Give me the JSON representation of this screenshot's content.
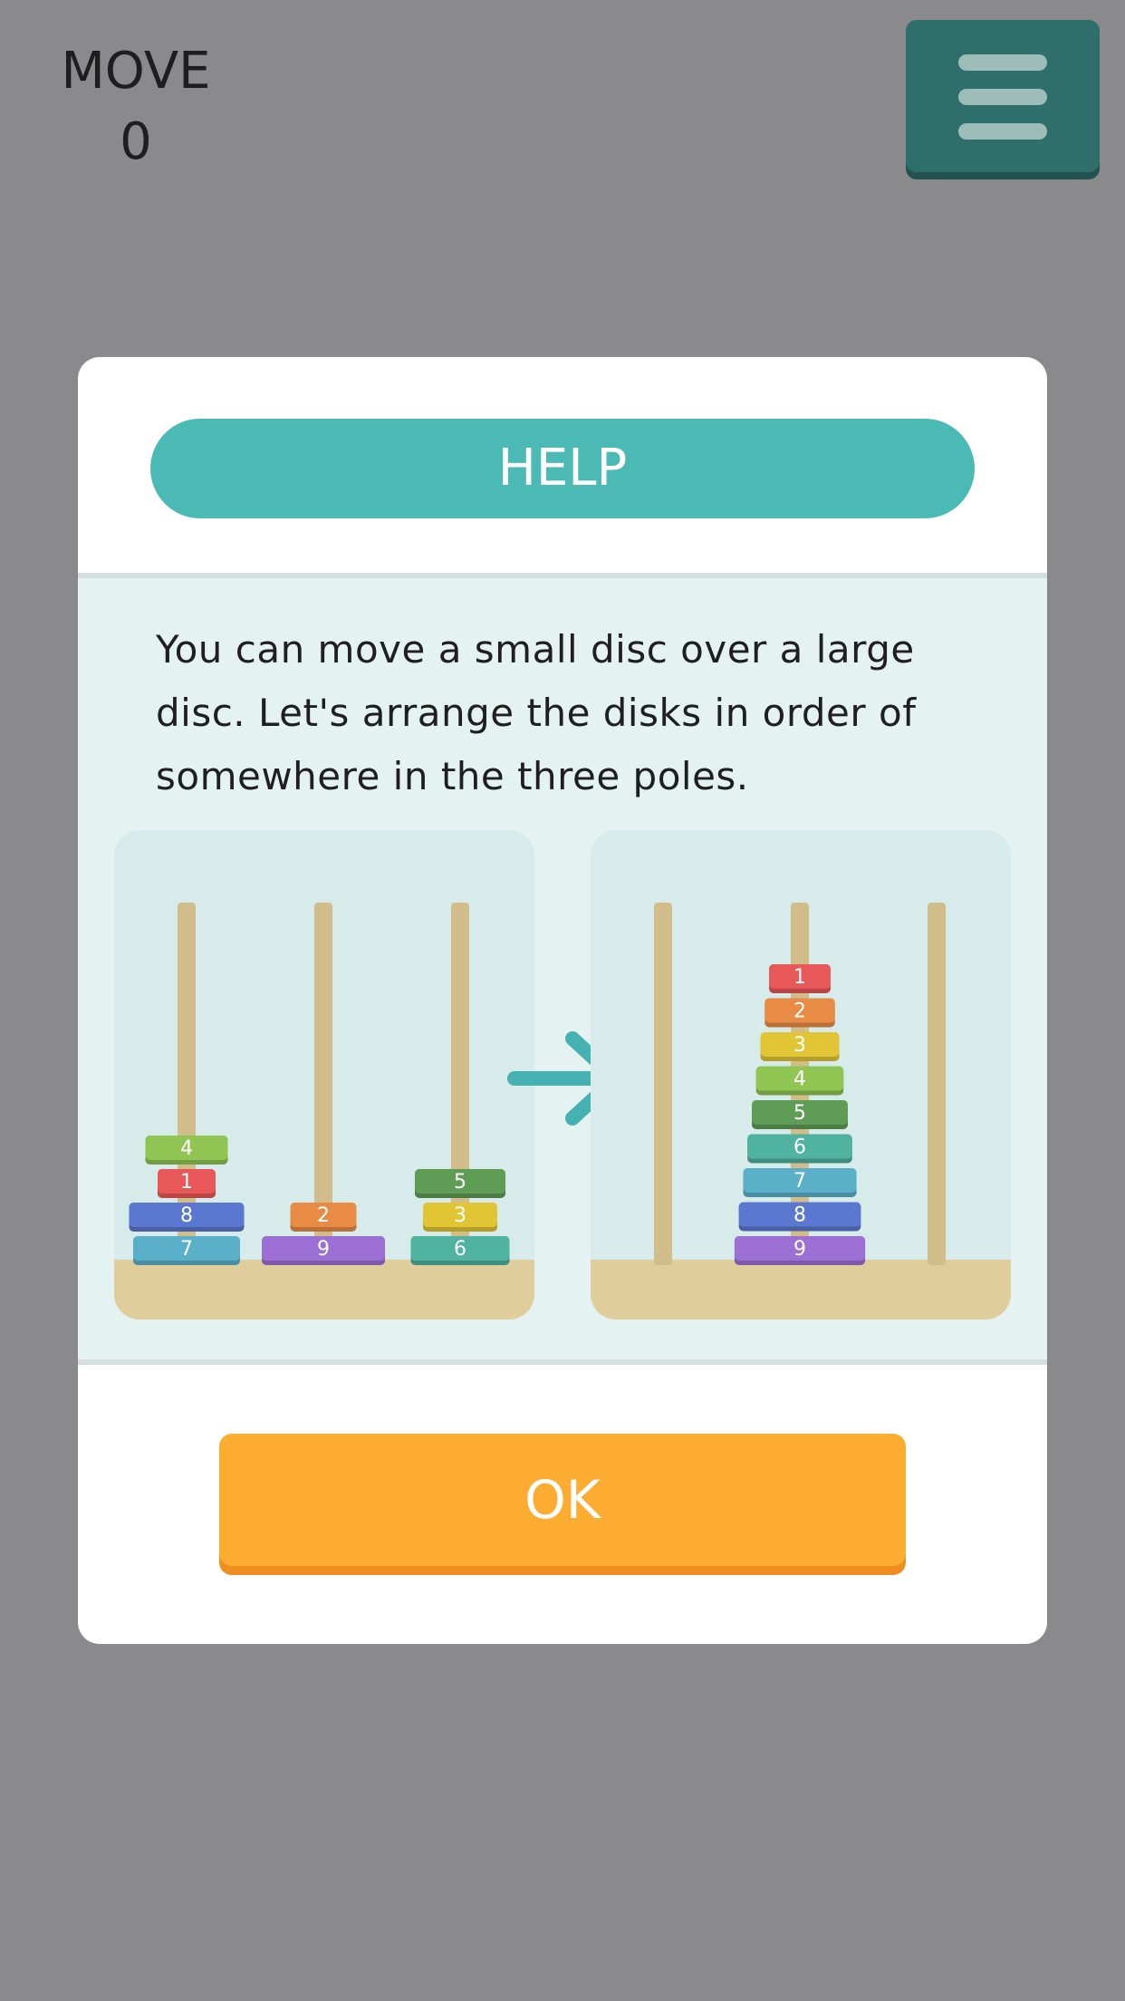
{
  "hud": {
    "move_label": "MOVE",
    "move_count": "0"
  },
  "dialog": {
    "title": "HELP",
    "text": "You can move a small disc over a large disc. Let's arrange the disks in order of somewhere in the three poles.",
    "ok_label": "OK"
  },
  "illustration": {
    "before": [
      {
        "pole": 0,
        "disks": [
          {
            "label": "7",
            "color": "#5ab0c9"
          },
          {
            "label": "8",
            "color": "#5b78d0"
          },
          {
            "label": "1",
            "color": "#e85858"
          },
          {
            "label": "4",
            "color": "#90c453"
          }
        ]
      },
      {
        "pole": 1,
        "disks": [
          {
            "label": "9",
            "color": "#9c6fd4"
          },
          {
            "label": "2",
            "color": "#e88c45"
          }
        ]
      },
      {
        "pole": 2,
        "disks": [
          {
            "label": "6",
            "color": "#4fb3a0"
          },
          {
            "label": "3",
            "color": "#e2c534"
          },
          {
            "label": "5",
            "color": "#5f9c55"
          }
        ]
      }
    ],
    "after": [
      {
        "label": "9",
        "color": "#9c6fd4"
      },
      {
        "label": "8",
        "color": "#5b78d0"
      },
      {
        "label": "7",
        "color": "#5ab0c9"
      },
      {
        "label": "6",
        "color": "#4fb3a0"
      },
      {
        "label": "5",
        "color": "#5f9c55"
      },
      {
        "label": "4",
        "color": "#90c453"
      },
      {
        "label": "3",
        "color": "#e2c534"
      },
      {
        "label": "2",
        "color": "#e88c45"
      },
      {
        "label": "1",
        "color": "#e85858"
      }
    ],
    "colors": {
      "pole": "#d1bd8a",
      "base": "#dfcd9b",
      "panel": "#d7ecea",
      "arrow": "#46b1b1"
    }
  }
}
